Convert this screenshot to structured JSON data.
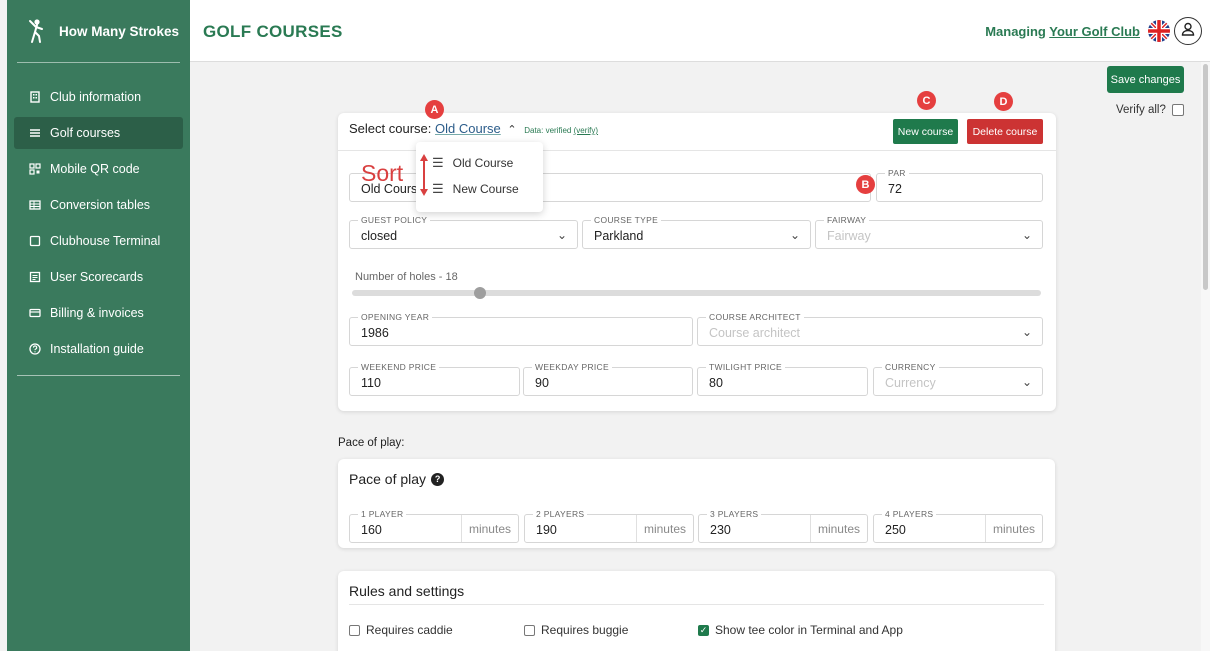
{
  "app": {
    "brand": "How Many Strokes",
    "page_title": "GOLF COURSES"
  },
  "header": {
    "managing_prefix": "Managing",
    "club_link": "Your Golf Club"
  },
  "sidebar": {
    "items": [
      {
        "label": "Club information",
        "icon": "building-icon"
      },
      {
        "label": "Golf courses",
        "icon": "list-icon",
        "active": true
      },
      {
        "label": "Mobile QR code",
        "icon": "qr-icon"
      },
      {
        "label": "Conversion tables",
        "icon": "table-icon"
      },
      {
        "label": "Clubhouse Terminal",
        "icon": "square-icon"
      },
      {
        "label": "User Scorecards",
        "icon": "scorecard-icon"
      },
      {
        "label": "Billing & invoices",
        "icon": "card-icon"
      },
      {
        "label": "Installation guide",
        "icon": "help-icon"
      }
    ]
  },
  "actions": {
    "save": "Save changes",
    "verify_all": "Verify all?"
  },
  "course": {
    "select_label": "Select course:",
    "selected": "Old Course",
    "data_status": "Data: verified",
    "verify_link": "(verify)",
    "new_button": "New course",
    "delete_button": "Delete course",
    "menu_options": [
      "Old Course",
      "New Course"
    ],
    "sort_label": "Sort",
    "course_name_value": "Old Course",
    "par": {
      "label": "PAR",
      "value": "72"
    },
    "guest_policy": {
      "label": "GUEST POLICY",
      "value": "closed"
    },
    "course_type": {
      "label": "COURSE TYPE",
      "value": "Parkland"
    },
    "fairway": {
      "label": "FAIRWAY",
      "placeholder": "Fairway"
    },
    "holes_label": "Number of holes - 18",
    "holes_value": 18,
    "opening_year": {
      "label": "OPENING YEAR",
      "value": "1986"
    },
    "architect": {
      "label": "COURSE ARCHITECT",
      "placeholder": "Course architect"
    },
    "weekend_price": {
      "label": "WEEKEND PRICE",
      "value": "110"
    },
    "weekday_price": {
      "label": "WEEKDAY PRICE",
      "value": "90"
    },
    "twilight_price": {
      "label": "TWILIGHT PRICE",
      "value": "80"
    },
    "currency": {
      "label": "CURRENCY",
      "placeholder": "Currency"
    }
  },
  "pace": {
    "heading": "Pace of play:",
    "card_title": "Pace of play",
    "unit": "minutes",
    "players": [
      {
        "label": "1 PLAYER",
        "value": "160"
      },
      {
        "label": "2 PLAYERS",
        "value": "190"
      },
      {
        "label": "3 PLAYERS",
        "value": "230"
      },
      {
        "label": "4 PLAYERS",
        "value": "250"
      }
    ]
  },
  "rules": {
    "title": "Rules and settings",
    "items": [
      {
        "label": "Requires caddie",
        "checked": false
      },
      {
        "label": "Requires buggie",
        "checked": false
      },
      {
        "label": "Show tee color in Terminal and App",
        "checked": true
      }
    ]
  },
  "markers": [
    "A",
    "B",
    "C",
    "D"
  ],
  "colors": {
    "sidebar": "#3a7a5d",
    "accent": "#1f7a4c",
    "danger": "#cc3333",
    "marker": "#e53f3f"
  }
}
